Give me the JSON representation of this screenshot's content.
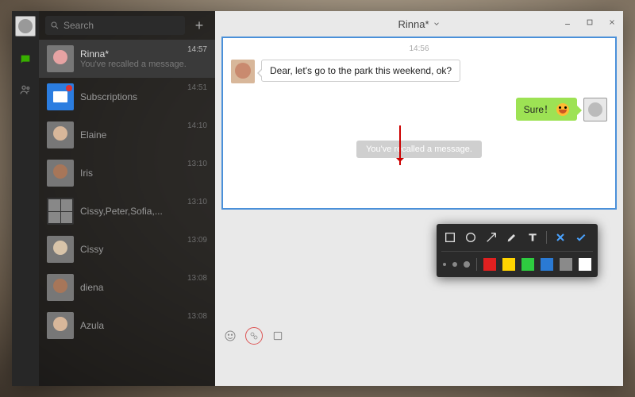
{
  "search": {
    "placeholder": "Search"
  },
  "sidebar": {
    "items": [
      {
        "name": "Rinna*",
        "sub": "You've recalled a message.",
        "time": "14:57"
      },
      {
        "name": "Subscriptions",
        "sub": "",
        "time": "14:51"
      },
      {
        "name": "Elaine",
        "sub": "",
        "time": "14:10"
      },
      {
        "name": "Iris",
        "sub": "",
        "time": "13:10"
      },
      {
        "name": "Cissy,Peter,Sofia,...",
        "sub": "",
        "time": "13:10"
      },
      {
        "name": "Cissy",
        "sub": "",
        "time": "13:09"
      },
      {
        "name": "diena",
        "sub": "",
        "time": "13:08"
      },
      {
        "name": "Azula",
        "sub": "",
        "time": "13:08"
      }
    ]
  },
  "chat": {
    "title": "Rinna*",
    "timestamp": "14:56",
    "incoming": "Dear, let's go to the park this weekend, ok?",
    "outgoing": "Sure！",
    "recall_notice": "You've recalled a message."
  },
  "toolbox_colors": [
    "#e02020",
    "#ffd400",
    "#2ecc40",
    "#2a7ad4",
    "#8a8a8a",
    "#ffffff"
  ]
}
